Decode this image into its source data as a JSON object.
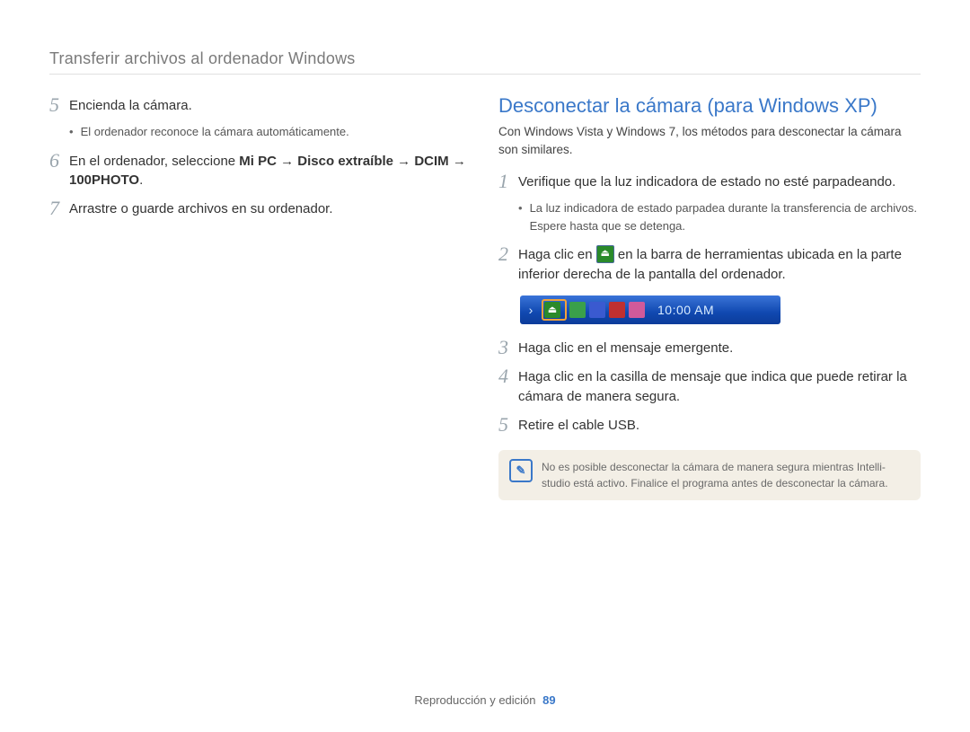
{
  "header": "Transferir archivos al ordenador Windows",
  "left": {
    "steps": [
      {
        "num": "5",
        "text": "Encienda la cámara.",
        "bullets": [
          "El ordenador reconoce la cámara automáticamente."
        ]
      },
      {
        "num": "6",
        "pre": "En el ordenador, seleccione ",
        "bold": "Mi PC → Disco extraíble → DCIM → 100PHOTO",
        "post": "."
      },
      {
        "num": "7",
        "text": "Arrastre o guarde archivos en su ordenador."
      }
    ]
  },
  "right": {
    "title": "Desconectar la cámara (para Windows XP)",
    "subtitle": "Con Windows Vista y Windows 7, los métodos para desconectar la cámara son similares.",
    "steps": [
      {
        "num": "1",
        "text": "Verifique que la luz indicadora de estado no esté parpadeando.",
        "bullets": [
          "La luz indicadora de estado parpadea durante la transferencia de archivos. Espere hasta que se detenga."
        ]
      },
      {
        "num": "2",
        "pre": "Haga clic en ",
        "icon": "safely-remove-icon",
        "post": " en la barra de herramientas ubicada en la parte inferior derecha de la pantalla del ordenador."
      },
      {
        "num": "3",
        "text": "Haga clic en el mensaje emergente."
      },
      {
        "num": "4",
        "text": "Haga clic en la casilla de mensaje que indica que puede retirar la cámara de manera segura."
      },
      {
        "num": "5",
        "text": "Retire el cable USB."
      }
    ],
    "taskbar_time": "10:00 AM",
    "note": "No es posible desconectar la cámara de manera segura mientras Intelli-studio está activo. Finalice el programa antes de desconectar la cámara."
  },
  "footer": {
    "section": "Reproducción y edición",
    "page": "89"
  }
}
